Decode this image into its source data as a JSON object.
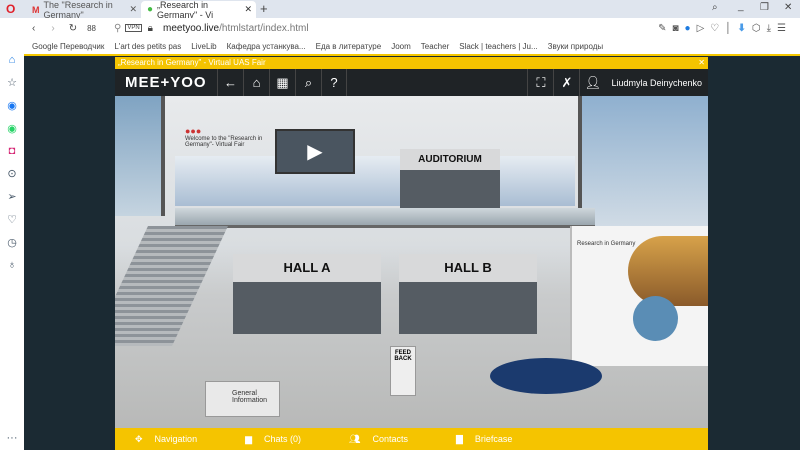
{
  "browser": {
    "tabs": [
      {
        "label": "The \"Research in Germany\""
      },
      {
        "label": "„Research in Germany\" - Vi"
      }
    ],
    "url_domain": "meetyoo.live",
    "url_path": "/htmlstart/index.html",
    "vpn": "VPN",
    "bookmarks": [
      "Google Переводчик",
      "L'art des petits pas",
      "LiveLib",
      "Кафедра устанкува...",
      "Еда в литературе",
      "Joom",
      "Teacher",
      "Slack | teachers | Ju...",
      "Звуки природы"
    ]
  },
  "app": {
    "title": "„Research in Germany\" - Virtual UAS Fair",
    "logo": "MEE+YOO",
    "user": "Liudmyla Deinychenko",
    "bottom": [
      {
        "icon": "move-icon",
        "label": "Navigation"
      },
      {
        "icon": "chat-icon",
        "label": "Chats (0)"
      },
      {
        "icon": "contacts-icon",
        "label": "Contacts"
      },
      {
        "icon": "folder-icon",
        "label": "Briefcase"
      }
    ]
  },
  "scene": {
    "welcome": "Welcome to the \"Research in Germany\"- Virtual Fair",
    "auditorium": "AUDITORIUM",
    "hall_a": "HALL A",
    "hall_b": "HALL B",
    "feedback": "FEED BACK",
    "info": "General Information",
    "booth": "Research in Germany"
  }
}
